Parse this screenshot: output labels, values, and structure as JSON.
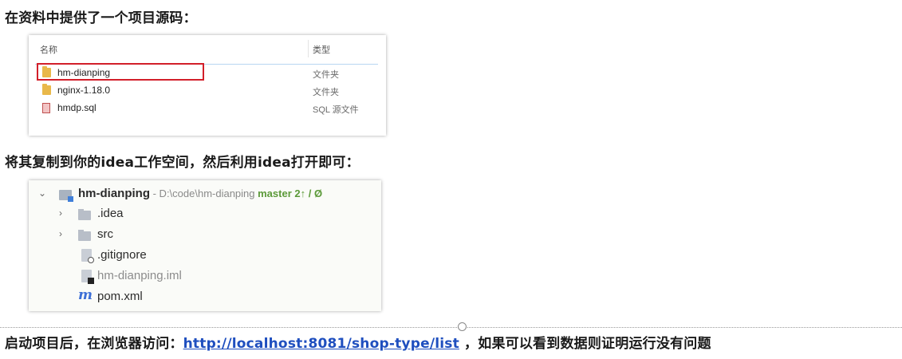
{
  "paragraphs": {
    "p1": "在资料中提供了一个项目源码：",
    "p2": "将其复制到你的idea工作空间，然后利用idea打开即可：",
    "p3_before": "启动项目后，在浏览器访问：",
    "p3_link": "http://localhost:8081/shop-type/list",
    "p3_after": " ，如果可以看到数据则证明运行没有问题"
  },
  "explorer": {
    "col_name": "名称",
    "col_type": "类型",
    "files": [
      {
        "name": "hm-dianping",
        "type": "文件夹",
        "icon": "folder-icon"
      },
      {
        "name": "nginx-1.18.0",
        "type": "文件夹",
        "icon": "folder-icon"
      },
      {
        "name": "hmdp.sql",
        "type": "SQL 源文件",
        "icon": "sql-file-icon"
      }
    ],
    "highlight_color": "#d21f2a"
  },
  "ide": {
    "root": {
      "name": "hm-dianping",
      "path": " - D:\\code\\hm-dianping ",
      "branch": "master 2↑ / Ø"
    },
    "items": [
      {
        "name": ".idea",
        "icon": "folder-icon",
        "expandable": true
      },
      {
        "name": "src",
        "icon": "folder-icon",
        "expandable": true
      },
      {
        "name": ".gitignore",
        "icon": "gitignore-file-icon",
        "expandable": false
      },
      {
        "name": "hm-dianping.iml",
        "icon": "iml-file-icon",
        "expandable": false
      },
      {
        "name": "pom.xml",
        "icon": "maven-icon",
        "expandable": false
      }
    ],
    "maven_glyph": "m",
    "branch_color": "#5c9a3a"
  },
  "colors": {
    "link": "#1f4fbf"
  }
}
